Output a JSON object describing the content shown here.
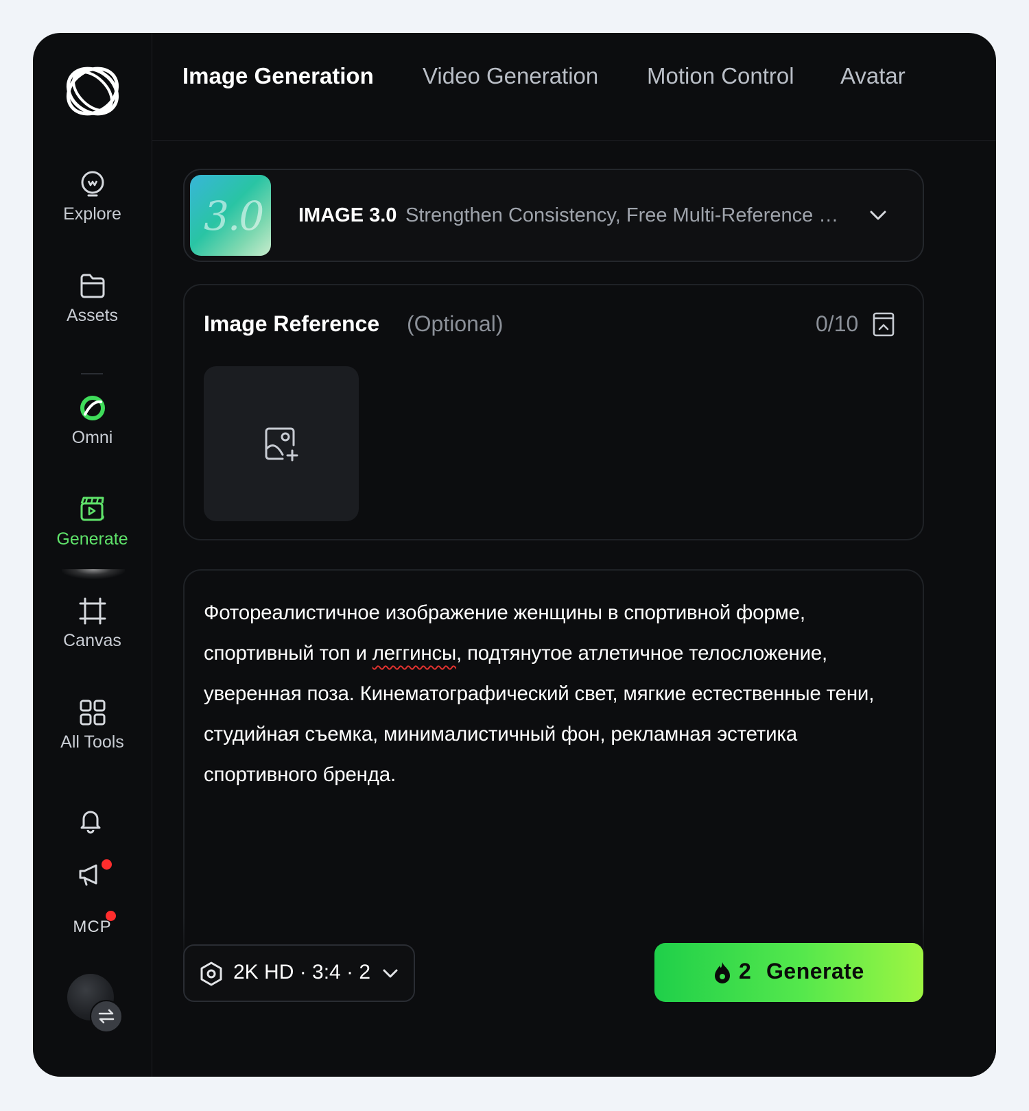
{
  "sidebar": {
    "items": [
      {
        "label": "Explore",
        "icon": "lightbulb-icon"
      },
      {
        "label": "Assets",
        "icon": "folder-icon"
      },
      {
        "label": "Omni",
        "icon": "omni-ring-icon"
      },
      {
        "label": "Generate",
        "icon": "generate-clapper-icon",
        "active": true
      },
      {
        "label": "Canvas",
        "icon": "canvas-frame-icon"
      },
      {
        "label": "All Tools",
        "icon": "grid-icon"
      }
    ],
    "mcp_label": "MCP",
    "accent_color": "#5fe26a",
    "notification_dot_color": "#ff2d2d"
  },
  "tabs": [
    {
      "label": "Image Generation",
      "active": true
    },
    {
      "label": "Video Generation"
    },
    {
      "label": "Motion Control"
    },
    {
      "label": "Avatar"
    }
  ],
  "model": {
    "thumb_text": "3.0",
    "name": "IMAGE 3.0",
    "description": "Strengthen Consistency, Free Multi-Reference Generation"
  },
  "reference": {
    "title": "Image Reference",
    "optional": "(Optional)",
    "count": "0/10"
  },
  "prompt": {
    "part1": "Фотореалистичное изображение женщины в спортивной форме, спортивный топ и ",
    "misspelled": "леггинсы",
    "part2": ", подтянутое атлетичное телосложение, уверенная поза. Кинематографический свет, мягкие естественные тени, студийная съемка, минималистичный фон, рекламная эстетика спортивного бренда."
  },
  "settings": {
    "summary": "2K HD · 3:4 · 2"
  },
  "generate": {
    "cost": "2",
    "label": "Generate"
  }
}
